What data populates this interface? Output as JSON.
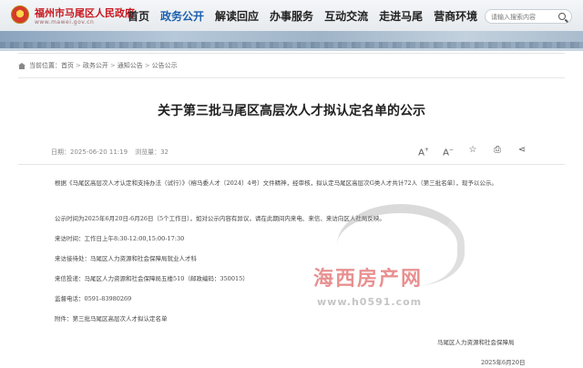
{
  "header": {
    "site_title": "福州市马尾区人民政府",
    "site_url": "www.mawei.gov.cn",
    "nav": [
      "首页",
      "政务公开",
      "解读回应",
      "办事服务",
      "互动交流",
      "走进马尾",
      "营商环境"
    ],
    "active_nav": "政务公开",
    "search_placeholder": "请输入搜索内容",
    "brand_color": "#c8161d",
    "accent_color": "#1b5fae"
  },
  "breadcrumb": {
    "label": "当前位置：",
    "items": [
      "首页",
      "政务公开",
      "通知公告",
      "公告公示"
    ]
  },
  "article": {
    "title": "关于第三批马尾区高层次人才拟认定名单的公示",
    "date": "日期：2025-06-20 11:19",
    "views_label": "浏览量：",
    "views": "32",
    "tools": [
      "font-increase-icon",
      "font-decrease-icon",
      "favorite-icon",
      "print-icon",
      "share-icon"
    ],
    "paragraphs": [
      "根据《马尾区高层次人才认定和支持办法（试行）》（榕马委人才〔2024〕4号）文件精神，经审核，拟认定马尾区高层次G类人才共计72人（第三批名单），现予以公示。",
      "公示时间为2025年6月20日-6月26日（5个工作日），如对公示内容有异议，请在此期间内来电、来信、来访向区人社局反映。",
      "来访时间：工作日上午8:30-12:00,15:00-17:30",
      "来访接待处：马尾区人力资源和社会保障局就业人才科",
      "来信投递：马尾区人力资源和社会保障局五楼510（邮政编码：350015）",
      "监督电话：0591-83980269",
      "附件：第三批马尾区高层次人才拟认定名单"
    ],
    "signature": "马尾区人力资源和社会保障局",
    "sign_date": "2025年6月20日"
  },
  "watermark": {
    "text": "海西房产网",
    "url": "www.h0591.com"
  }
}
